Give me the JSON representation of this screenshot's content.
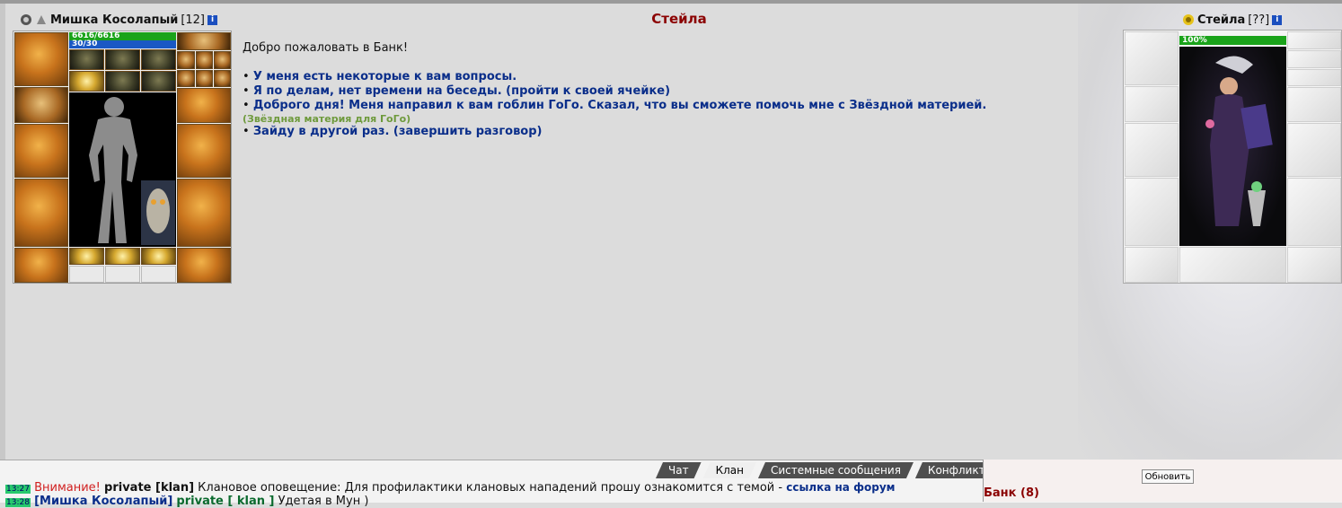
{
  "player": {
    "name": "Мишка Косолапый",
    "level": "[12]",
    "hp": "6616/6616",
    "mp": "30/30"
  },
  "npc": {
    "title": "Стейла",
    "name": "Стейла",
    "level": "[??]",
    "hp": "100%"
  },
  "dialog": {
    "greeting": "Добро пожаловать в Банк!",
    "options": [
      {
        "label": "У меня есть некоторые к вам вопросы."
      },
      {
        "label": "Я по делам, нет времени на беседы. (пройти к своей ячейке)"
      },
      {
        "label": "Доброго дня! Меня направил к вам гоблин ГоГо. Сказал, что вы сможете помочь мне с Звёздной материей.",
        "hint": "(Звёздная материя для ГоГо)"
      },
      {
        "label": "Зайду в другой раз. (завершить разговор)"
      }
    ]
  },
  "chat": {
    "tabs": [
      "Чат",
      "Клан",
      "Системные сообщения",
      "Конфликты"
    ],
    "active_tab": "Клан",
    "lines": [
      {
        "time": "13:27",
        "warning": "Внимание!",
        "sender": "private [klan]",
        "text": "Клановое оповещение: Для профилактики клановых нападений прошу ознакомится с темой -",
        "link": "ссылка на форум"
      },
      {
        "time": "13:28",
        "sender_player": "[Мишка Косолапый]",
        "sender": "private [ klan ]",
        "text": "Удетая в Мун )"
      }
    ]
  },
  "sidebar": {
    "refresh_label": "Обновить",
    "location": "Банк (8)"
  },
  "colors": {
    "npc_title": "#8b0000",
    "option_link": "#0a2e8a",
    "hint": "#6e9a3c",
    "hp_bar": "#1aa31a",
    "mp_bar": "#1a58c4"
  }
}
